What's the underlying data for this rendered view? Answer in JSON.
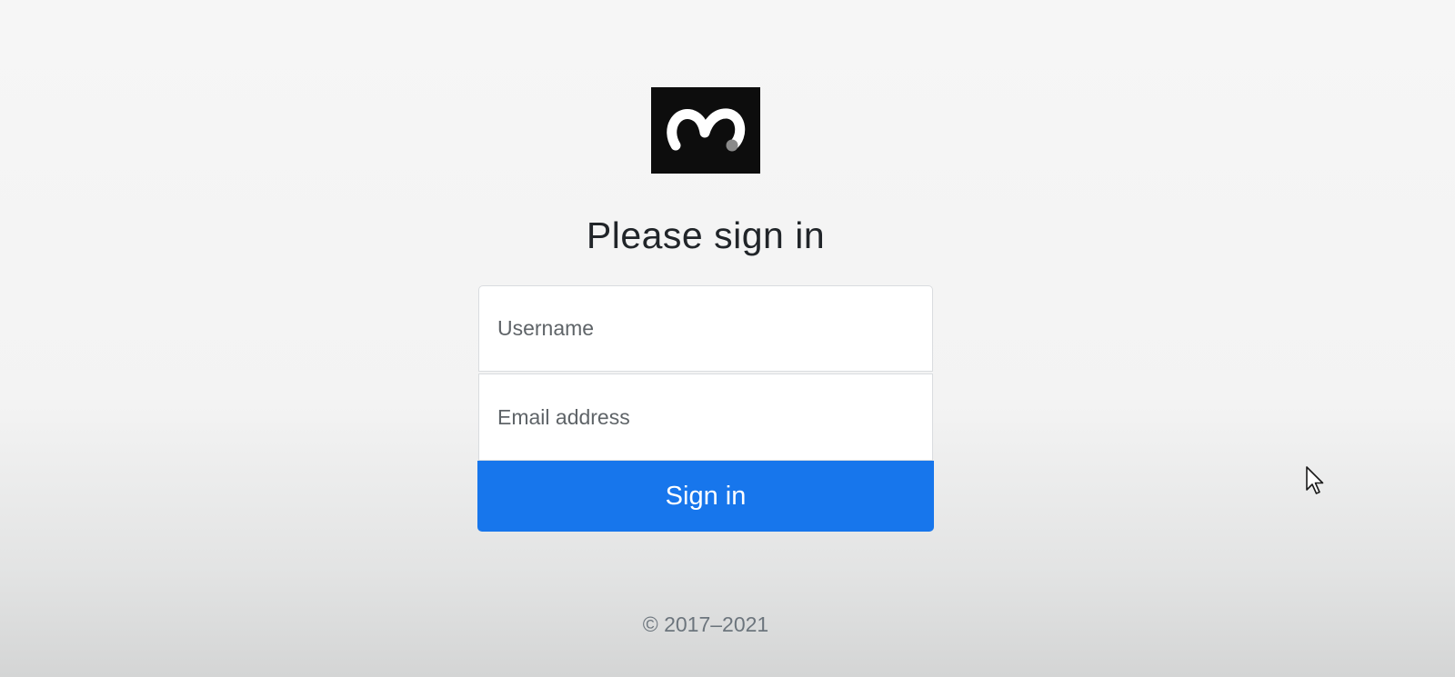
{
  "header": {
    "logo_icon": "m-logo-icon",
    "title": "Please sign in"
  },
  "form": {
    "username_placeholder": "Username",
    "email_placeholder": "Email address",
    "submit_label": "Sign in"
  },
  "footer": {
    "copyright": "© 2017–2021"
  },
  "colors": {
    "background": "#f4f4f4",
    "logo_bg": "#0d0d0d",
    "primary_button": "#1776ec",
    "title_text": "#212529",
    "footer_text": "#6c757d"
  },
  "icons": {
    "cursor": "mouse-pointer-icon"
  }
}
